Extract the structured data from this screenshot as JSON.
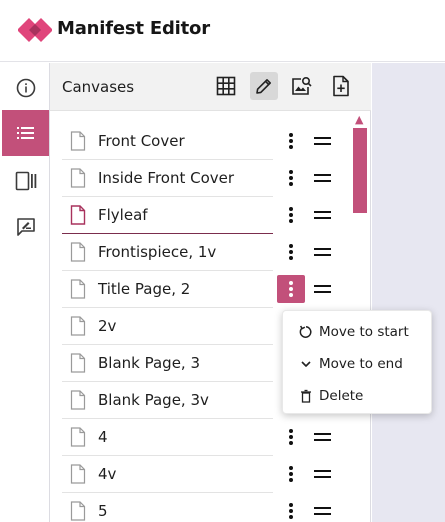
{
  "app": {
    "title": "Manifest Editor"
  },
  "panel": {
    "title": "Canvases",
    "tools": [
      "grid-view-icon",
      "edit-icon",
      "image-search-icon",
      "add-document-icon"
    ],
    "active_tool": "edit-icon"
  },
  "rail": {
    "items": [
      "info-icon",
      "list-icon",
      "canvas-strip-icon",
      "annotation-icon"
    ],
    "active": "list-icon"
  },
  "canvases": [
    {
      "label": "Front Cover"
    },
    {
      "label": "Inside Front Cover"
    },
    {
      "label": "Flyleaf"
    },
    {
      "label": "Frontispiece, 1v"
    },
    {
      "label": "Title Page, 2"
    },
    {
      "label": "2v"
    },
    {
      "label": "Blank Page, 3"
    },
    {
      "label": "Blank Page, 3v"
    },
    {
      "label": "4"
    },
    {
      "label": "4v"
    },
    {
      "label": "5"
    }
  ],
  "selected_canvas": "Flyleaf",
  "menu_open_for": "Title Page, 2",
  "context_menu": {
    "items": [
      {
        "label": "Move to start",
        "icon": "rotate-icon"
      },
      {
        "label": "Move to end",
        "icon": "chevron-down-icon"
      },
      {
        "label": "Delete",
        "icon": "trash-icon"
      }
    ]
  },
  "colors": {
    "accent": "#c2507a",
    "selected_underline": "#7b2d4d",
    "logo": "#e0457b"
  }
}
